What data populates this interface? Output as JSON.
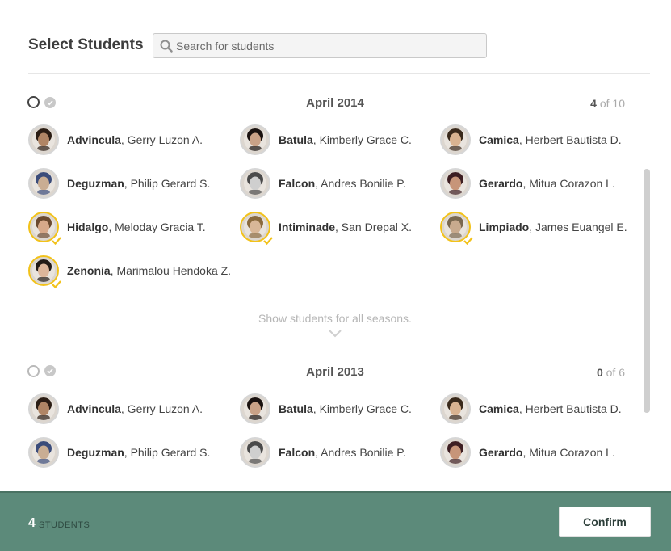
{
  "header": {
    "title": "Select Students",
    "search_placeholder": "Search for students"
  },
  "colors": {
    "accent": "#f2c21a",
    "footer": "#5c8a7a"
  },
  "sections": [
    {
      "title": "April 2014",
      "selected": "4",
      "of": "of",
      "total": "10",
      "students": [
        {
          "last": "Advincula",
          "rest": ", Gerry Luzon A.",
          "selected": false,
          "skin": "#b08565",
          "hair": "#2b1d14"
        },
        {
          "last": "Batula",
          "rest": ", Kimberly Grace C.",
          "selected": false,
          "skin": "#caa287",
          "hair": "#1a1210"
        },
        {
          "last": "Camica",
          "rest": ", Herbert Bautista D.",
          "selected": false,
          "skin": "#d9b391",
          "hair": "#3a2a1c"
        },
        {
          "last": "Deguzman",
          "rest": ", Philip Gerard S.",
          "selected": false,
          "skin": "#c9ad93",
          "hair": "#3b4c7a"
        },
        {
          "last": "Falcon",
          "rest": ", Andres Bonilie P.",
          "selected": false,
          "skin": "#cfcfcf",
          "hair": "#4a4a4a"
        },
        {
          "last": "Gerardo",
          "rest": ", Mitua Corazon L.",
          "selected": false,
          "skin": "#c79579",
          "hair": "#3d1e22"
        },
        {
          "last": "Hidalgo",
          "rest": ", Meloday Gracia T.",
          "selected": true,
          "skin": "#d7a98a",
          "hair": "#6b4a30"
        },
        {
          "last": "Intiminade",
          "rest": ", San Drepal X.",
          "selected": true,
          "skin": "#d8b798",
          "hair": "#8a6a3e"
        },
        {
          "last": "Limpiado",
          "rest": ", James Euangel E.",
          "selected": true,
          "skin": "#c8aa8e",
          "hair": "#7a6850"
        },
        {
          "last": "Zenonia",
          "rest": ", Marimalou Hendoka Z.",
          "selected": true,
          "skin": "#dcb59a",
          "hair": "#221a16"
        }
      ]
    },
    {
      "title": "April 2013",
      "selected": "0",
      "of": "of",
      "total": "6",
      "students": [
        {
          "last": "Advincula",
          "rest": ", Gerry Luzon A.",
          "selected": false,
          "skin": "#b08565",
          "hair": "#2b1d14"
        },
        {
          "last": "Batula",
          "rest": ", Kimberly Grace C.",
          "selected": false,
          "skin": "#caa287",
          "hair": "#1a1210"
        },
        {
          "last": "Camica",
          "rest": ", Herbert Bautista D.",
          "selected": false,
          "skin": "#d9b391",
          "hair": "#3a2a1c"
        },
        {
          "last": "Deguzman",
          "rest": ", Philip Gerard S.",
          "selected": false,
          "skin": "#c9ad93",
          "hair": "#3b4c7a"
        },
        {
          "last": "Falcon",
          "rest": ", Andres Bonilie P.",
          "selected": false,
          "skin": "#cfcfcf",
          "hair": "#4a4a4a"
        },
        {
          "last": "Gerardo",
          "rest": ", Mitua Corazon L.",
          "selected": false,
          "skin": "#c79579",
          "hair": "#3d1e22"
        }
      ]
    }
  ],
  "show_all": "Show students for all seasons.",
  "footer": {
    "count": "4",
    "count_label": "STUDENTS",
    "confirm_label": "Confirm"
  }
}
